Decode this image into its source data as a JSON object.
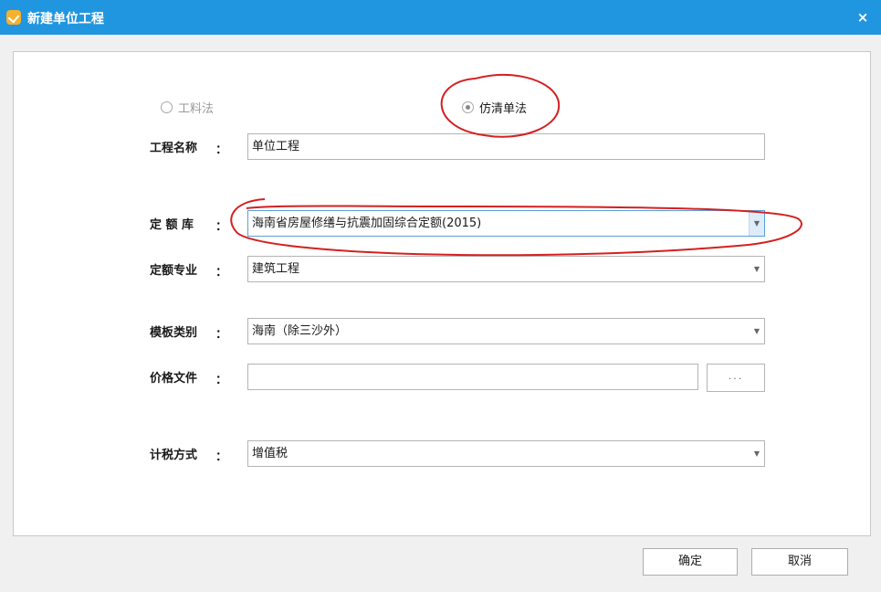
{
  "window": {
    "title": "新建单位工程",
    "close_label": "×"
  },
  "method": {
    "options": [
      {
        "label": "工料法",
        "selected": false,
        "enabled": false
      },
      {
        "label": "仿清单法",
        "selected": true,
        "enabled": true
      }
    ]
  },
  "form": {
    "project_name": {
      "label": "工程名称",
      "colon": "：",
      "value": "单位工程"
    },
    "quota_library": {
      "label": "定 额 库",
      "colon": "：",
      "value": "海南省房屋修缮与抗震加固综合定额(2015)"
    },
    "quota_specialty": {
      "label": "定额专业",
      "colon": "：",
      "value": "建筑工程"
    },
    "template_category": {
      "label": "模板类别",
      "colon": "：",
      "value": "海南（除三沙外）"
    },
    "price_file": {
      "label": "价格文件",
      "colon": "：",
      "value": "",
      "browse_label": "..."
    },
    "tax_method": {
      "label": "计税方式",
      "colon": "：",
      "value": "增值税"
    }
  },
  "buttons": {
    "ok": "确定",
    "cancel": "取消"
  },
  "colors": {
    "titlebar": "#2196e0",
    "annotation": "#d42020"
  },
  "icons": {
    "app": "app-icon",
    "dropdown": "chevron-down-icon"
  }
}
